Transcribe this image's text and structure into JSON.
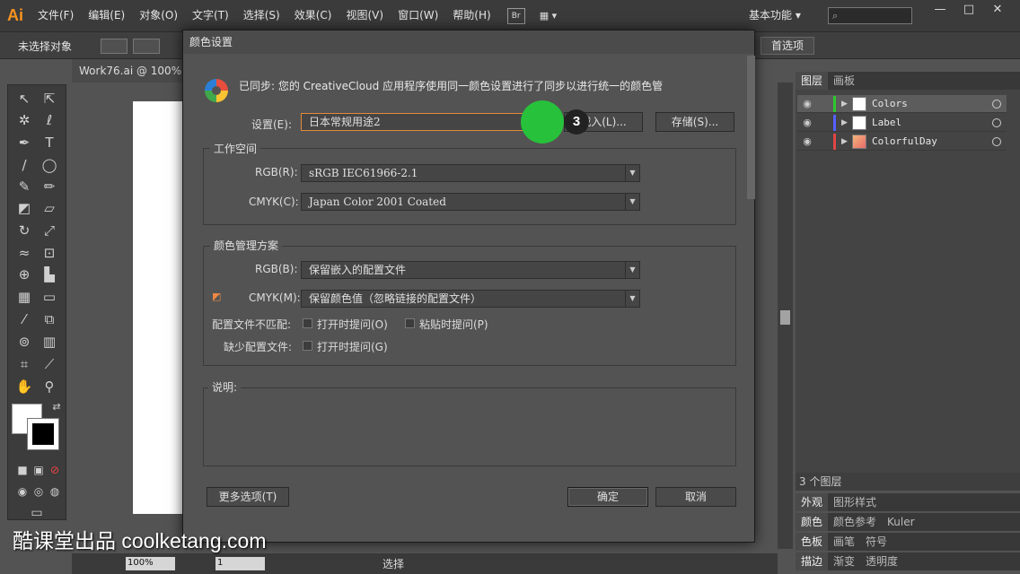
{
  "app": {
    "logo": "Ai",
    "menus": [
      "文件(F)",
      "编辑(E)",
      "对象(O)",
      "文字(T)",
      "选择(S)",
      "效果(C)",
      "视图(V)",
      "窗口(W)",
      "帮助(H)"
    ],
    "bridge_label": "Br",
    "workspace": "基本功能",
    "workspace_arrow": "▾",
    "search_placeholder": "",
    "window_buttons": [
      "—",
      "□",
      "✕"
    ]
  },
  "controlbar": {
    "selection_label": "未选择对象",
    "prefs_button": "首选项"
  },
  "document": {
    "tab_title": "Work76.ai @ 100%",
    "zoom": "100%",
    "artboard_num": "1",
    "status": "选择"
  },
  "layers_panel": {
    "tabs": [
      "图层",
      "画板"
    ],
    "layers": [
      {
        "name": "Colors",
        "color": "#2ec72e",
        "selected": true
      },
      {
        "name": "Label",
        "color": "#5560ff",
        "selected": false
      },
      {
        "name": "ColorfulDay",
        "color": "#e04545",
        "selected": false
      }
    ],
    "footer_count": "3 个图层"
  },
  "right_panels": {
    "appearance_tabs": [
      "外观",
      "图形样式"
    ],
    "color_tabs": [
      "颜色",
      "颜色参考",
      "Kuler"
    ],
    "swatch_tabs": [
      "色板",
      "画笔",
      "符号"
    ],
    "stroke_tabs": [
      "描边",
      "渐变",
      "透明度"
    ]
  },
  "dialog": {
    "title": "颜色设置",
    "sync_message": "已同步: 您的 CreativeCloud 应用程序使用同一颜色设置进行了同步以进行统一的颜色管",
    "settings_label": "设置(E):",
    "settings_value": "日本常规用途2",
    "load_button": "载入(L)...",
    "save_button": "存储(S)...",
    "workspace_title": "工作空间",
    "rgb_label": "RGB(R):",
    "rgb_value": "sRGB IEC61966-2.1",
    "cmyk_label": "CMYK(C):",
    "cmyk_value": "Japan Color 2001 Coated",
    "policy_title": "颜色管理方案",
    "policy_rgb_label": "RGB(B):",
    "policy_rgb_value": "保留嵌入的配置文件",
    "policy_cmyk_label": "CMYK(M):",
    "policy_cmyk_value": "保留颜色值（忽略链接的配置文件）",
    "mismatch_label": "配置文件不匹配:",
    "mismatch_open": "打开时提问(O)",
    "mismatch_paste": "粘贴时提问(P)",
    "missing_label": "缺少配置文件:",
    "missing_open": "打开时提问(G)",
    "desc_title": "说明:",
    "more_options": "更多选项(T)",
    "ok": "确定",
    "cancel": "取消"
  },
  "overlay": {
    "step_number": "3",
    "watermark": "酷课堂出品 coolketang.com"
  }
}
